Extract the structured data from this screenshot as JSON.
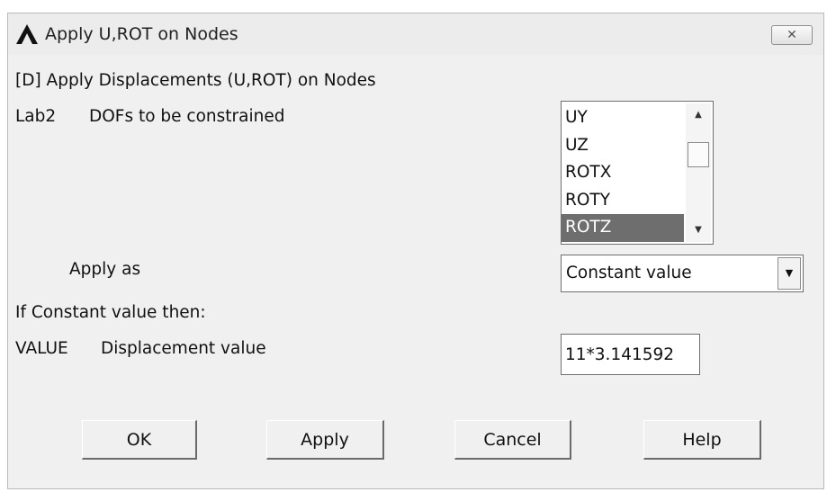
{
  "window": {
    "title": "Apply U,ROT on Nodes",
    "close_glyph": "✕"
  },
  "header": {
    "description": "[D]  Apply Displacements (U,ROT) on Nodes"
  },
  "lab2": {
    "code": "Lab2",
    "label": "DOFs to be constrained",
    "items": [
      {
        "label": "UY",
        "selected": false
      },
      {
        "label": "UZ",
        "selected": false
      },
      {
        "label": "ROTX",
        "selected": false
      },
      {
        "label": "ROTY",
        "selected": false
      },
      {
        "label": "ROTZ",
        "selected": true
      }
    ]
  },
  "apply_as": {
    "label": "Apply as",
    "selected": "Constant value"
  },
  "constant_hint": "If Constant value then:",
  "value_field": {
    "code": "VALUE",
    "label": "Displacement value",
    "value": "11*3.141592"
  },
  "buttons": {
    "ok": "OK",
    "apply": "Apply",
    "cancel": "Cancel",
    "help": "Help"
  },
  "colors": {
    "selection": "#6e6e6e",
    "dialog_bg": "#f0f0f0"
  }
}
